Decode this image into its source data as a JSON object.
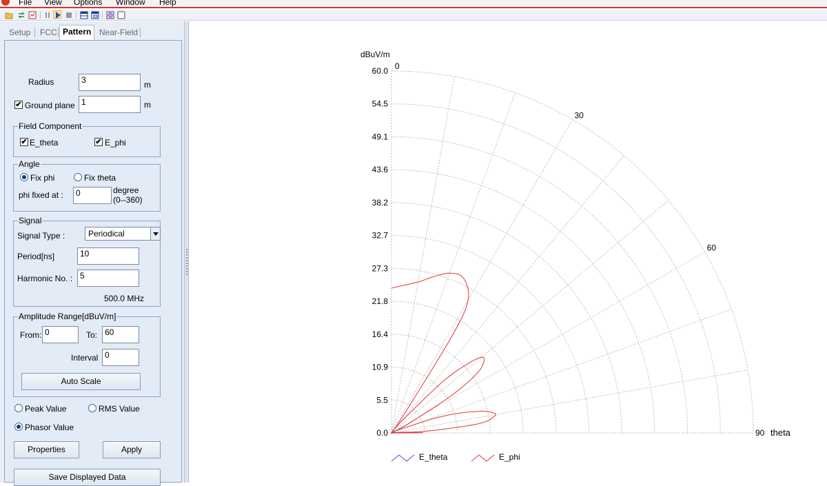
{
  "menu": [
    "File",
    "View",
    "Options",
    "Window",
    "Help"
  ],
  "toolbar": {
    "icons": [
      "open-icon",
      "swap-icon",
      "report-icon",
      "pause-icon",
      "play-icon",
      "stop-icon",
      "split-horizontal-icon",
      "window-icon",
      "grid-icon",
      "blank-icon"
    ]
  },
  "tabs": [
    "Setup",
    "FCC",
    "Pattern",
    "Near-Field"
  ],
  "active_tab": "Pattern",
  "pattern": {
    "radius_label": "Radius",
    "radius_value": "3",
    "radius_unit": "m",
    "ground_plane_label": "Ground plane",
    "ground_plane_checked": true,
    "ground_plane_value": "1",
    "ground_plane_unit": "m",
    "field_component": {
      "title": "Field Component",
      "e_theta_label": "E_theta",
      "e_theta_checked": true,
      "e_phi_label": "E_phi",
      "e_phi_checked": true
    },
    "angle": {
      "title": "Angle",
      "fix_phi_label": "Fix phi",
      "fix_theta_label": "Fix theta",
      "selected": "Fix phi",
      "phi_fixed_label": "phi fixed at :",
      "phi_fixed_value": "0",
      "unit_line1": "degree",
      "unit_line2": "(0--360)"
    },
    "signal": {
      "title": "Signal",
      "type_label": "Signal Type :",
      "type_value": "Periodical",
      "period_label": "Period[ns]",
      "period_value": "10",
      "harmonic_label": "Harmonic No. :",
      "harmonic_value": "5",
      "frequency": "500.0 MHz"
    },
    "amplitude": {
      "title": "Amplitude Range[dBuV/m]",
      "from_label": "From:",
      "from_value": "0",
      "to_label": "To:",
      "to_value": "60",
      "interval_label": "Interval",
      "interval_value": "0",
      "auto_scale_label": "Auto Scale"
    },
    "value_mode": {
      "peak_label": "Peak Value",
      "rms_label": "RMS Value",
      "phasor_label": "Phasor Value",
      "selected": "Phasor Value"
    },
    "properties_label": "Properties",
    "apply_label": "Apply",
    "save_label": "Save Displayed Data"
  },
  "colors": {
    "e_theta": "#4b4bd6",
    "e_phi": "#e83030",
    "grid": "#bdbdbd"
  },
  "chart_data": {
    "type": "polar-quadrant",
    "radial_unit": "dBuV/m",
    "angle_label": "theta",
    "radial_range": [
      0,
      60
    ],
    "radial_ticks": [
      "0.0",
      "5.5",
      "10.9",
      "16.4",
      "21.8",
      "27.3",
      "32.7",
      "38.2",
      "43.6",
      "49.1",
      "54.5",
      "60.0"
    ],
    "angle_ticks": [
      "0",
      "30",
      "60",
      "90"
    ],
    "grid": true,
    "legend_position": "bottom",
    "series": [
      {
        "name": "E_theta",
        "points": [
          [
            82,
            0
          ],
          [
            85,
            0.6
          ],
          [
            87,
            2.4
          ],
          [
            88,
            3.4
          ],
          [
            89,
            2.6
          ],
          [
            90,
            0
          ]
        ]
      },
      {
        "name": "E_phi",
        "points": [
          [
            0,
            24
          ],
          [
            5,
            24.6
          ],
          [
            10,
            25.4
          ],
          [
            15,
            26.8
          ],
          [
            20,
            28.2
          ],
          [
            25,
            28.3
          ],
          [
            30,
            25.4
          ],
          [
            32,
            19
          ],
          [
            34,
            4
          ],
          [
            35,
            0
          ],
          [
            40,
            2
          ],
          [
            45,
            12
          ],
          [
            48,
            17.3
          ],
          [
            50,
            19.5
          ],
          [
            52,
            19.5
          ],
          [
            55,
            17.5
          ],
          [
            58,
            12
          ],
          [
            62,
            3
          ],
          [
            63,
            0
          ],
          [
            67,
            1.5
          ],
          [
            72,
            9
          ],
          [
            76,
            14.8
          ],
          [
            79,
            17.3
          ],
          [
            81,
            17.2
          ],
          [
            84,
            14.5
          ],
          [
            87,
            6
          ],
          [
            88.5,
            0
          ],
          [
            89.2,
            4
          ],
          [
            89.7,
            5
          ],
          [
            90,
            0
          ]
        ]
      }
    ]
  }
}
